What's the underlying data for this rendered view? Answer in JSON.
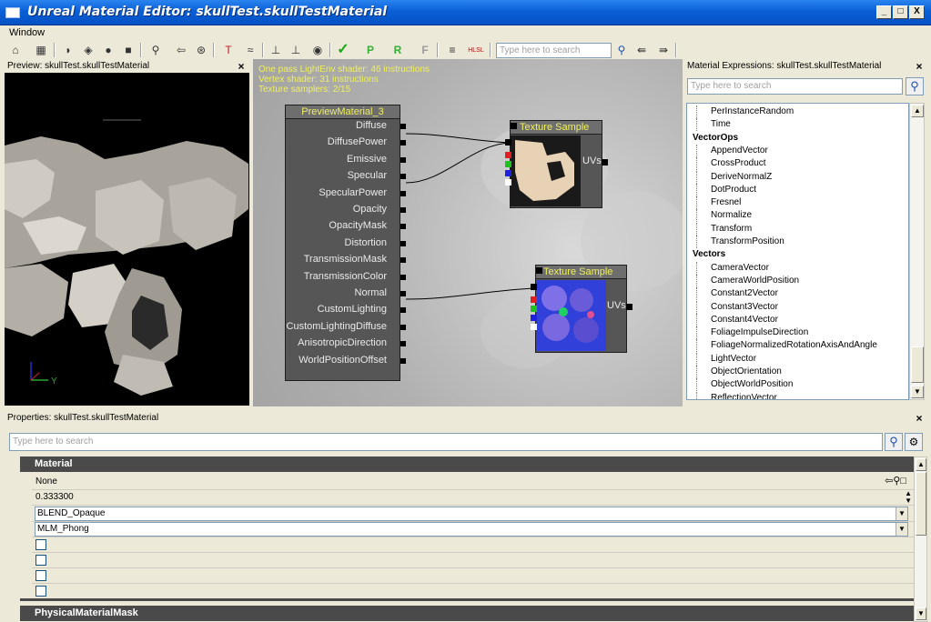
{
  "window": {
    "title": "Unreal Material Editor: skullTest.skullTestMaterial",
    "minimize": "_",
    "maximize": "□",
    "close": "X"
  },
  "menu": {
    "window": "Window"
  },
  "toolbar": {
    "search_placeholder": "Type here to search",
    "p_label": "P",
    "r_label": "R",
    "f_label": "F",
    "hlsl_label": "HLSL"
  },
  "preview": {
    "title": "Preview: skullTest.skullTestMaterial",
    "axis_y": "Y",
    "close": "×"
  },
  "canvas": {
    "info": [
      "One pass LightEnv shader: 46 instructions",
      "Vertex shader: 31 instructions",
      "Texture samplers: 2/15"
    ],
    "material_node": {
      "title": "PreviewMaterial_3",
      "inputs": [
        "Diffuse",
        "DiffusePower",
        "Emissive",
        "Specular",
        "SpecularPower",
        "Opacity",
        "OpacityMask",
        "Distortion",
        "TransmissionMask",
        "TransmissionColor",
        "Normal",
        "CustomLighting",
        "CustomLightingDiffuse",
        "AnisotropicDirection",
        "WorldPositionOffset"
      ]
    },
    "texture_nodes": [
      {
        "title": "Texture Sample",
        "output": "UVs"
      },
      {
        "title": "Texture Sample",
        "output": "UVs"
      }
    ]
  },
  "expressions": {
    "title": "Material Expressions: skullTest.skullTestMaterial",
    "search_placeholder": "Type here to search",
    "close": "×",
    "items": [
      {
        "text": "PerInstanceRandom",
        "kind": "item"
      },
      {
        "text": "Time",
        "kind": "item"
      },
      {
        "text": "VectorOps",
        "kind": "cat"
      },
      {
        "text": "AppendVector",
        "kind": "item"
      },
      {
        "text": "CrossProduct",
        "kind": "item"
      },
      {
        "text": "DeriveNormalZ",
        "kind": "item"
      },
      {
        "text": "DotProduct",
        "kind": "item"
      },
      {
        "text": "Fresnel",
        "kind": "item"
      },
      {
        "text": "Normalize",
        "kind": "item"
      },
      {
        "text": "Transform",
        "kind": "item"
      },
      {
        "text": "TransformPosition",
        "kind": "item"
      },
      {
        "text": "Vectors",
        "kind": "cat"
      },
      {
        "text": "CameraVector",
        "kind": "item"
      },
      {
        "text": "CameraWorldPosition",
        "kind": "item"
      },
      {
        "text": "Constant2Vector",
        "kind": "item"
      },
      {
        "text": "Constant3Vector",
        "kind": "item"
      },
      {
        "text": "Constant4Vector",
        "kind": "item"
      },
      {
        "text": "FoliageImpulseDirection",
        "kind": "item"
      },
      {
        "text": "FoliageNormalizedRotationAxisAndAngle",
        "kind": "item"
      },
      {
        "text": "LightVector",
        "kind": "item"
      },
      {
        "text": "ObjectOrientation",
        "kind": "item"
      },
      {
        "text": "ObjectWorldPosition",
        "kind": "item"
      },
      {
        "text": "ReflectionVector",
        "kind": "item"
      }
    ]
  },
  "properties": {
    "title": "Properties: skullTest.skullTestMaterial",
    "close": "×",
    "search_placeholder": "Type here to search",
    "category": "Material",
    "category2": "PhysicalMaterialMask",
    "rows": {
      "phys_material": "None",
      "opacity_mask_clip": "0.333300",
      "blend_mode": "BLEND_Opaque",
      "lighting_model": "MLM_Phong"
    }
  }
}
